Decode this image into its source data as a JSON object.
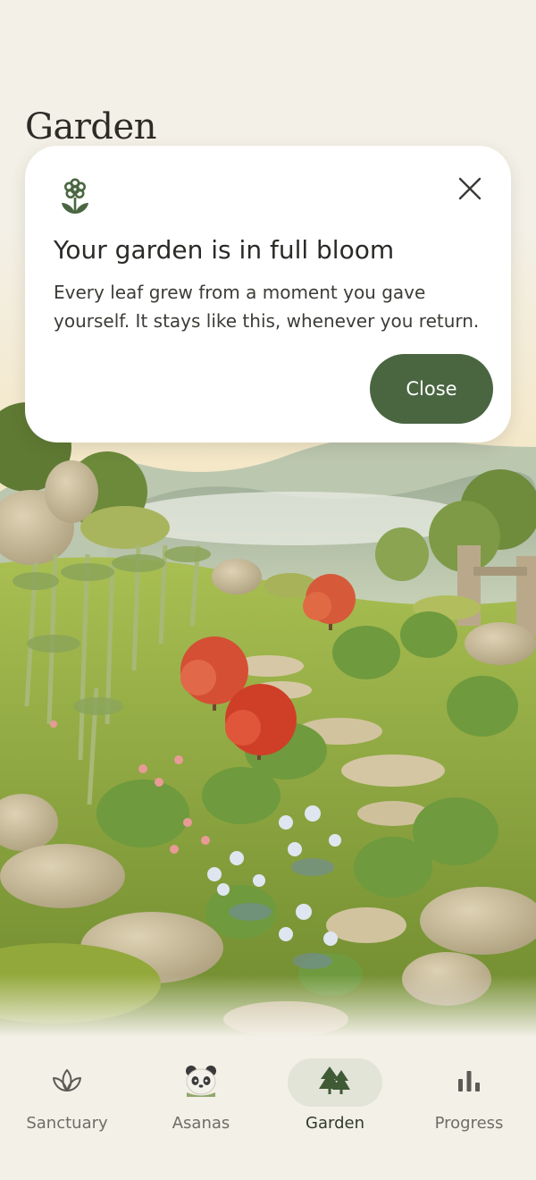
{
  "page": {
    "title": "Garden"
  },
  "modal": {
    "title": "Your garden is in full bloom",
    "body": "Every leaf grew from a moment you gave yourself. It stays like this, whenever you return.",
    "close_button_label": "Close",
    "icon": "flower-icon",
    "dismiss_icon": "close-icon"
  },
  "nav": {
    "items": [
      {
        "label": "Sanctuary",
        "icon": "lotus-icon",
        "active": false
      },
      {
        "label": "Asanas",
        "icon": "panda-icon",
        "active": false
      },
      {
        "label": "Garden",
        "icon": "trees-icon",
        "active": true
      },
      {
        "label": "Progress",
        "icon": "bar-chart-icon",
        "active": false
      }
    ]
  },
  "colors": {
    "background": "#f3f0e7",
    "accent": "#4a6641",
    "card": "#ffffff",
    "active_pill": "#e2e4d8"
  }
}
